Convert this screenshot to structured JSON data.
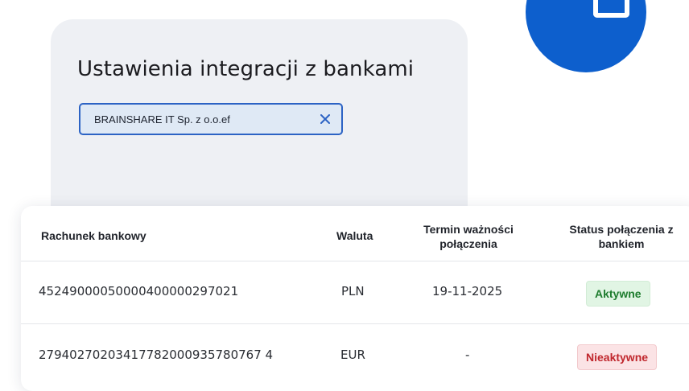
{
  "settings": {
    "title": "Ustawienia integracji z bankami",
    "company_select": {
      "value": "BRAINSHARE IT Sp. z o.o.ef",
      "clear_icon": "close-icon"
    }
  },
  "brand": {
    "icon": "window-square-icon",
    "color": "#0d5fcd"
  },
  "table": {
    "columns": {
      "account": "Rachunek bankowy",
      "currency": "Waluta",
      "expiry": "Termin ważności połączenia",
      "status": "Status połączenia z bankiem"
    },
    "rows": [
      {
        "account": "45249000050000400000297021",
        "currency": "PLN",
        "expiry": "19-11-2025",
        "status": "Aktywne",
        "status_color": "#1f7d2f"
      },
      {
        "account": "27940270203417782000935780767 4",
        "currency": "EUR",
        "expiry": "-",
        "status": "Nieaktywne",
        "status_color": "#c0272d"
      }
    ]
  }
}
